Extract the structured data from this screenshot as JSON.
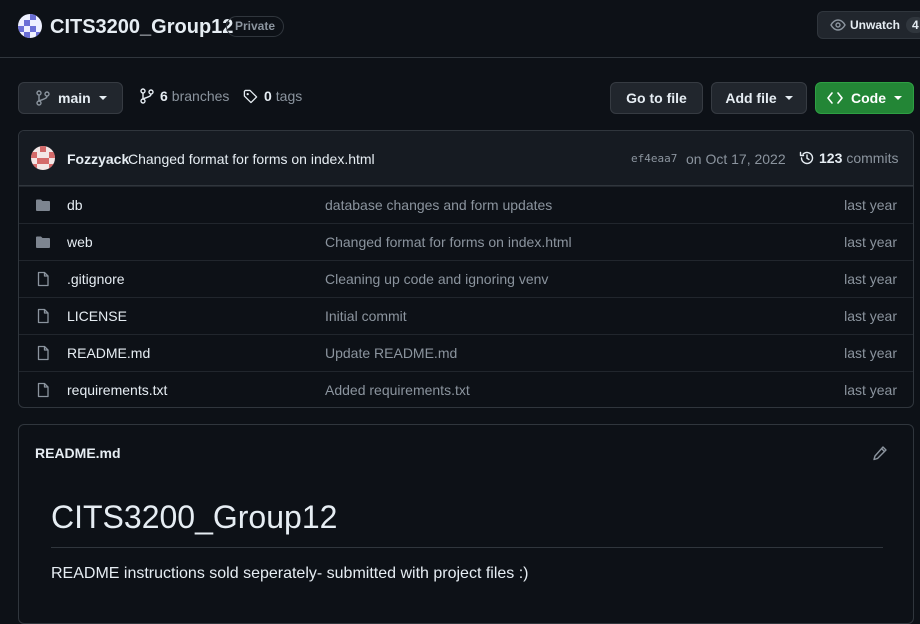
{
  "header": {
    "repo_name": "CITS3200_Group12",
    "visibility": "Private",
    "unwatch_label": "Unwatch",
    "watch_count": "4"
  },
  "toolbar": {
    "branch": "main",
    "branches_count": "6",
    "branches_label": "branches",
    "tags_count": "0",
    "tags_label": "tags",
    "goto_label": "Go to file",
    "add_file_label": "Add file",
    "code_label": "Code"
  },
  "commit": {
    "author": "Fozzyack",
    "message": "Changed format for forms on index.html",
    "sha": "ef4eaa7",
    "date": "on Oct 17, 2022",
    "count": "123",
    "count_label": "commits"
  },
  "files": [
    {
      "type": "folder",
      "name": "db",
      "message": "database changes and form updates",
      "age": "last year"
    },
    {
      "type": "folder",
      "name": "web",
      "message": "Changed format for forms on index.html",
      "age": "last year"
    },
    {
      "type": "file",
      "name": ".gitignore",
      "message": "Cleaning up code and ignoring venv",
      "age": "last year"
    },
    {
      "type": "file",
      "name": "LICENSE",
      "message": "Initial commit",
      "age": "last year"
    },
    {
      "type": "file",
      "name": "README.md",
      "message": "Update README.md",
      "age": "last year"
    },
    {
      "type": "file",
      "name": "requirements.txt",
      "message": "Added requirements.txt",
      "age": "last year"
    }
  ],
  "readme": {
    "title": "README.md",
    "heading": "CITS3200_Group12",
    "body": "README instructions sold seperately- submitted with project files :)"
  },
  "colors": {
    "background": "#0d1117",
    "border": "#30363d",
    "muted": "#8b949e",
    "code_button": "#238636",
    "folder_icon": "#7d8590"
  }
}
